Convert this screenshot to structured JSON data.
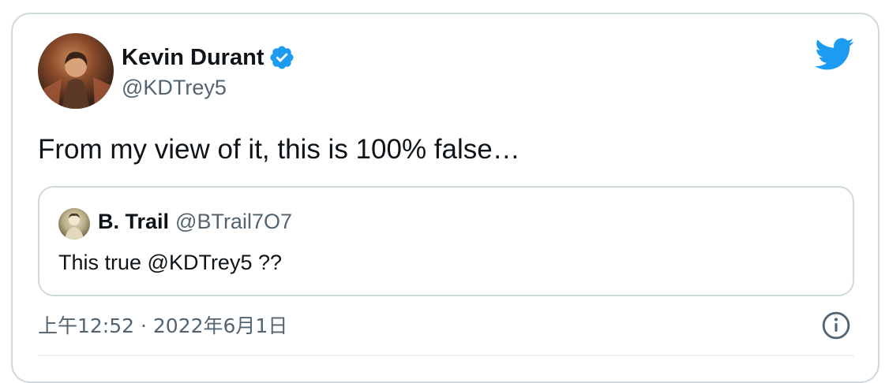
{
  "tweet": {
    "author": {
      "name": "Kevin Durant",
      "handle": "@KDTrey5",
      "verified": true,
      "avatar_icon": "avatar-photo"
    },
    "text": "From my view of it, this is 100% false…",
    "quoted": {
      "author_name": "B. Trail",
      "author_handle": "@BTrail7O7",
      "text": "This true @KDTrey5 ??",
      "avatar_icon": "avatar-photo"
    },
    "timestamp": "上午12:52 · 2022年6月1日"
  },
  "icons": {
    "brand": "twitter-bird-icon",
    "info": "info-icon",
    "verified": "verified-badge-icon"
  },
  "colors": {
    "brand": "#1d9bf0",
    "text_primary": "#0f1419",
    "text_secondary": "#536471",
    "border": "#cfd9de"
  }
}
